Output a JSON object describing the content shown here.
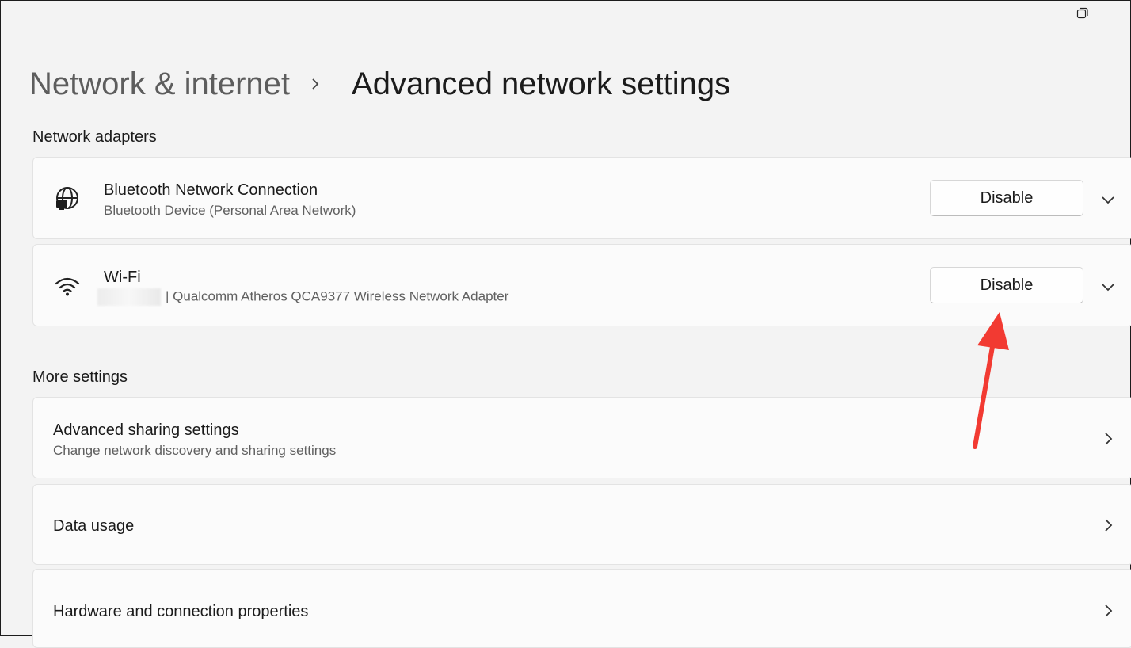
{
  "breadcrumb": {
    "parent": "Network & internet",
    "current": "Advanced network settings"
  },
  "sections": {
    "network_adapters": "Network adapters",
    "more_settings": "More settings"
  },
  "adapters": [
    {
      "icon": "globe-monitor-icon",
      "name": "Bluetooth Network Connection",
      "description": "Bluetooth Device (Personal Area Network)",
      "button": "Disable"
    },
    {
      "icon": "wifi-icon",
      "name": "Wi-Fi",
      "description": "| Qualcomm Atheros QCA9377 Wireless Network Adapter",
      "button": "Disable"
    }
  ],
  "more_settings": [
    {
      "title": "Advanced sharing settings",
      "subtitle": "Change network discovery and sharing settings"
    },
    {
      "title": "Data usage"
    },
    {
      "title": "Hardware and connection properties"
    }
  ],
  "colors": {
    "annotation_arrow": "#f23a32",
    "background": "#f3f3f3",
    "card": "#fbfbfb"
  }
}
